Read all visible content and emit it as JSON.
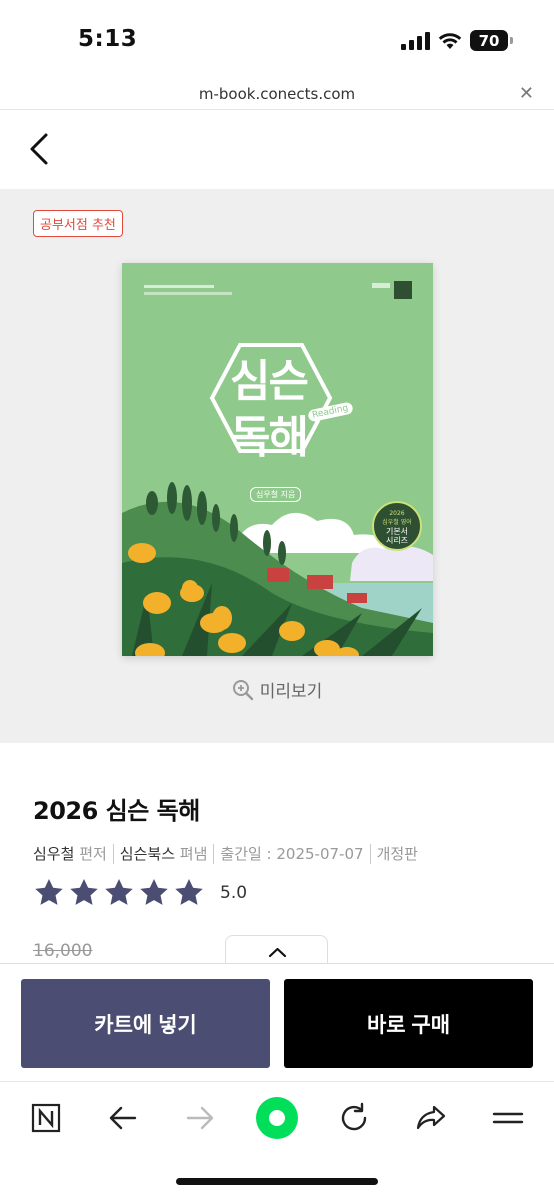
{
  "status": {
    "time": "5:13",
    "battery": "70"
  },
  "url_bar": {
    "domain": "m-book.conects.com"
  },
  "hero": {
    "badge": "공부서점 추천",
    "preview_label": "미리보기",
    "cover": {
      "title_line1": "심슨",
      "title_line2": "독해",
      "tag": "Reading",
      "author_label": "심우철 지음",
      "series_year": "2026",
      "series_line1": "심우철 영어",
      "series_line2": "기본서",
      "series_line3": "시리즈",
      "colors": {
        "background": "#8fc98b",
        "hill": "#4c8c4e",
        "flower": "#f3b12b"
      }
    }
  },
  "product": {
    "title": "2026 심슨 독해",
    "author": "심우철",
    "author_role": "편저",
    "publisher": "심슨북스",
    "publisher_role": "펴냄",
    "release_date": "출간일 : 2025-07-07",
    "edition": "개정판",
    "rating_score": "5.0",
    "rating_stars": 5,
    "list_price": "16,000"
  },
  "cta": {
    "cart_label": "카트에 넣기",
    "buy_label": "바로 구매"
  },
  "colors": {
    "cart_button": "#4b4d72",
    "buy_button": "#000000",
    "badge": "#e24a3b",
    "star": "#4b4d72",
    "naver_green": "#00de5a"
  },
  "toolbar": {
    "icons": [
      "naver-n-icon",
      "back-arrow-icon",
      "forward-arrow-icon",
      "green-home-icon",
      "reload-icon",
      "share-icon",
      "menu-icon"
    ]
  }
}
